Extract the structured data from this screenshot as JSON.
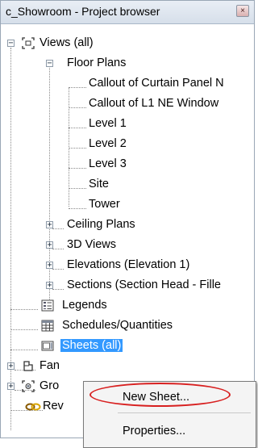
{
  "window": {
    "title": "c_Showroom - Project browser",
    "close_glyph": "×"
  },
  "tree": {
    "views": "Views (all)",
    "floor_plans": "Floor Plans",
    "floor_plan_items": [
      "Callout of Curtain Panel N",
      "Callout of L1 NE Window",
      "Level 1",
      "Level 2",
      "Level 3",
      "Site",
      "Tower"
    ],
    "ceiling_plans": "Ceiling Plans",
    "views_3d": "3D Views",
    "elevations": "Elevations (Elevation 1)",
    "sections": "Sections (Section Head - Fille",
    "legends": "Legends",
    "schedules": "Schedules/Quantities",
    "sheets": "Sheets (all)",
    "families": "Fan",
    "groups": "Gro",
    "revit_links": "Rev",
    "expand_glyph": "+",
    "collapse_glyph": "−"
  },
  "context_menu": {
    "new_sheet": "New Sheet...",
    "properties": "Properties..."
  },
  "colors": {
    "selection": "#3399ff",
    "highlight_ellipse": "#d82020"
  },
  "icons": [
    "views-icon",
    "legends-icon",
    "schedules-icon",
    "sheets-icon",
    "families-icon",
    "groups-icon",
    "revit-links-icon"
  ]
}
